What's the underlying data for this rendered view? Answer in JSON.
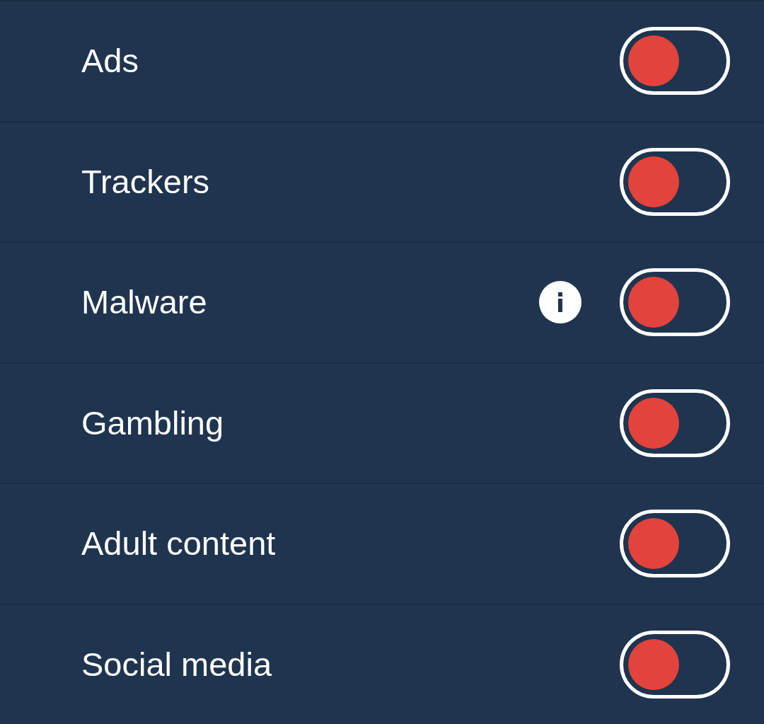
{
  "rows": [
    {
      "label": "Ads",
      "info_icon": false,
      "on": false
    },
    {
      "label": "Trackers",
      "info_icon": false,
      "on": false
    },
    {
      "label": "Malware",
      "info_icon": true,
      "on": false
    },
    {
      "label": "Gambling",
      "info_icon": false,
      "on": false
    },
    {
      "label": "Adult content",
      "info_icon": false,
      "on": false
    },
    {
      "label": "Social media",
      "info_icon": false,
      "on": false
    }
  ]
}
